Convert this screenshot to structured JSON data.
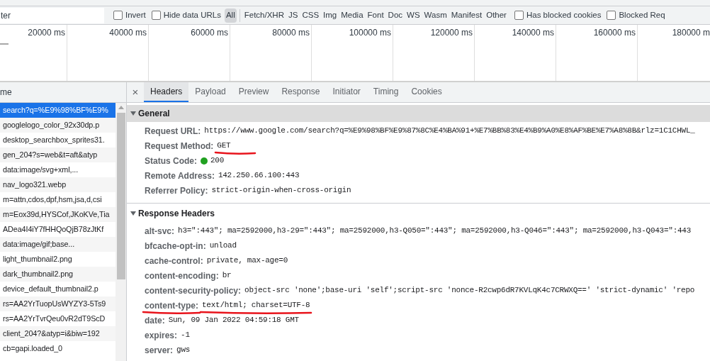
{
  "filter_bar": {
    "filter_value": "ter",
    "checks": [
      {
        "label": "Invert",
        "checked": false
      },
      {
        "label": "Hide data URLs",
        "checked": false
      }
    ],
    "types": [
      {
        "label": "All",
        "selected": true
      },
      {
        "label": "Fetch/XHR",
        "selected": false
      },
      {
        "label": "JS",
        "selected": false
      },
      {
        "label": "CSS",
        "selected": false
      },
      {
        "label": "Img",
        "selected": false
      },
      {
        "label": "Media",
        "selected": false
      },
      {
        "label": "Font",
        "selected": false
      },
      {
        "label": "Doc",
        "selected": false
      },
      {
        "label": "WS",
        "selected": false
      },
      {
        "label": "Wasm",
        "selected": false
      },
      {
        "label": "Manifest",
        "selected": false
      },
      {
        "label": "Other",
        "selected": false
      }
    ],
    "extra_checks": [
      {
        "label": "Has blocked cookies",
        "checked": false
      },
      {
        "label": "Blocked Req",
        "checked": false
      }
    ]
  },
  "timeline": {
    "ticks": [
      "20000 ms",
      "40000 ms",
      "60000 ms",
      "80000 ms",
      "100000 ms",
      "120000 ms",
      "140000 ms",
      "160000 ms",
      "180000 m"
    ]
  },
  "requests": {
    "column": "me",
    "rows": [
      {
        "name": "search?q=%E9%98%BF%E9%",
        "selected": true
      },
      {
        "name": "googlelogo_color_92x30dp.p",
        "selected": false
      },
      {
        "name": "desktop_searchbox_sprites31.",
        "selected": false
      },
      {
        "name": "gen_204?s=web&t=aft&atyp",
        "selected": false
      },
      {
        "name": "data:image/svg+xml,...",
        "selected": false
      },
      {
        "name": "nav_logo321.webp",
        "selected": false
      },
      {
        "name": "m=attn,cdos,dpf,hsm,jsa,d,csi",
        "selected": false
      },
      {
        "name": "m=Eox39d,HYSCof,JKoKVe,Tia",
        "selected": false
      },
      {
        "name": "ADea4I4iY7fHHQoQjB78zJtKf",
        "selected": false
      },
      {
        "name": "data:image/gif;base...",
        "selected": false
      },
      {
        "name": "light_thumbnail2.png",
        "selected": false
      },
      {
        "name": "dark_thumbnail2.png",
        "selected": false
      },
      {
        "name": "device_default_thumbnail2.p",
        "selected": false
      },
      {
        "name": "rs=AA2YrTuopUsWYZY3-5Ts9",
        "selected": false
      },
      {
        "name": "rs=AA2YrTvrQeu0vR2dT9ScD",
        "selected": false
      },
      {
        "name": "client_204?&atyp=i&biw=192",
        "selected": false
      },
      {
        "name": "cb=gapi.loaded_0",
        "selected": false
      }
    ]
  },
  "detail": {
    "close": "×",
    "tabs": [
      {
        "label": "Headers",
        "selected": true
      },
      {
        "label": "Payload",
        "selected": false
      },
      {
        "label": "Preview",
        "selected": false
      },
      {
        "label": "Response",
        "selected": false
      },
      {
        "label": "Initiator",
        "selected": false
      },
      {
        "label": "Timing",
        "selected": false
      },
      {
        "label": "Cookies",
        "selected": false
      }
    ],
    "sections": [
      {
        "title": "General",
        "expanded": true,
        "kind": "general",
        "rows": [
          {
            "name": "Request URL:",
            "value": "https://www.google.com/search?q=%E9%98%BF%E9%87%8C%E4%BA%91+%E7%BB%83%E4%B9%A0%E8%AF%BE%E7%A8%8B&rlz=1C1CHWL_",
            "name_marked": false,
            "value_marked": false,
            "status_ok": false
          },
          {
            "name": "Request Method:",
            "value": "GET",
            "name_marked": false,
            "value_marked": true,
            "status_ok": false
          },
          {
            "name": "Status Code:",
            "value": "200",
            "name_marked": false,
            "value_marked": false,
            "status_ok": true
          },
          {
            "name": "Remote Address:",
            "value": "142.250.66.100:443",
            "name_marked": false,
            "value_marked": false,
            "status_ok": false
          },
          {
            "name": "Referrer Policy:",
            "value": "strict-origin-when-cross-origin",
            "name_marked": false,
            "value_marked": false,
            "status_ok": false
          }
        ]
      },
      {
        "title": "Response Headers",
        "expanded": true,
        "kind": "headers",
        "rows": [
          {
            "name": "alt-svc:",
            "value": "h3=\":443\"; ma=2592000,h3-29=\":443\"; ma=2592000,h3-Q050=\":443\"; ma=2592000,h3-Q046=\":443\"; ma=2592000,h3-Q043=\":443",
            "name_marked": false,
            "value_marked": false
          },
          {
            "name": "bfcache-opt-in:",
            "value": "unload",
            "name_marked": false,
            "value_marked": false
          },
          {
            "name": "cache-control:",
            "value": "private, max-age=0",
            "name_marked": false,
            "value_marked": false
          },
          {
            "name": "content-encoding:",
            "value": "br",
            "name_marked": false,
            "value_marked": false
          },
          {
            "name": "content-security-policy:",
            "value": "object-src 'none';base-uri 'self';script-src 'nonce-R2cwp6dR7KVLqK4c7CRWXQ==' 'strict-dynamic' 'repo",
            "name_marked": false,
            "value_marked": false
          },
          {
            "name": "content-type:",
            "value": "text/html; charset=UTF-8",
            "name_marked": true,
            "value_marked": true
          },
          {
            "name": "date:",
            "value": "Sun, 09 Jan 2022 04:59:18 GMT",
            "name_marked": false,
            "value_marked": false
          },
          {
            "name": "expires:",
            "value": "-1",
            "name_marked": false,
            "value_marked": false
          },
          {
            "name": "server:",
            "value": "gws",
            "name_marked": false,
            "value_marked": false
          }
        ]
      }
    ]
  }
}
